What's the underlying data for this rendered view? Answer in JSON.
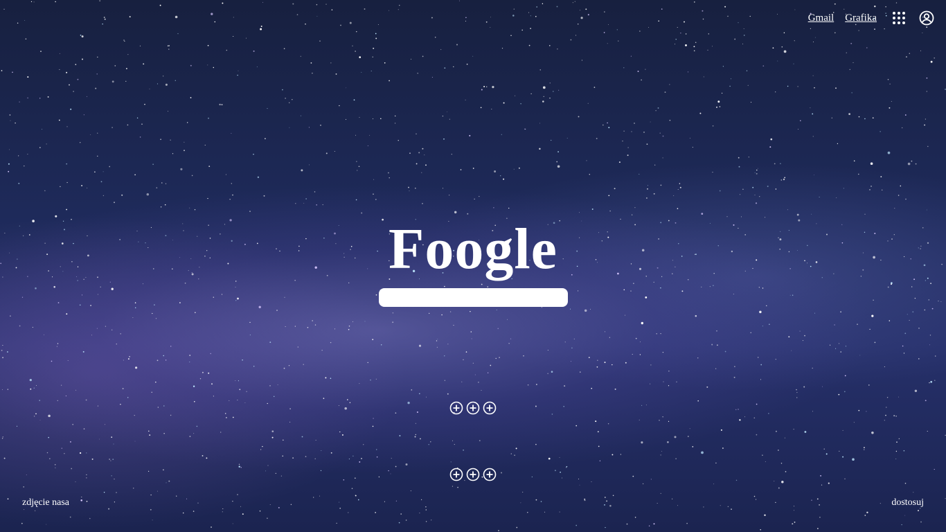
{
  "header": {
    "gmail_label": "Gmail",
    "images_label": "Grafika",
    "icons": {
      "apps": "grid-apps-icon",
      "account": "account-circle-icon"
    }
  },
  "logo": {
    "text": "Foogle"
  },
  "search": {
    "value": "",
    "placeholder": ""
  },
  "shortcuts": {
    "row1_count": 3,
    "row2_count": 3,
    "icon": "add-circle-icon"
  },
  "footer": {
    "left_label": "zdjęcie nasa",
    "right_label": "dostosuj"
  },
  "colors": {
    "text": "#ffffff",
    "background": "#1e2a5a",
    "search_background": "#ffffff"
  }
}
